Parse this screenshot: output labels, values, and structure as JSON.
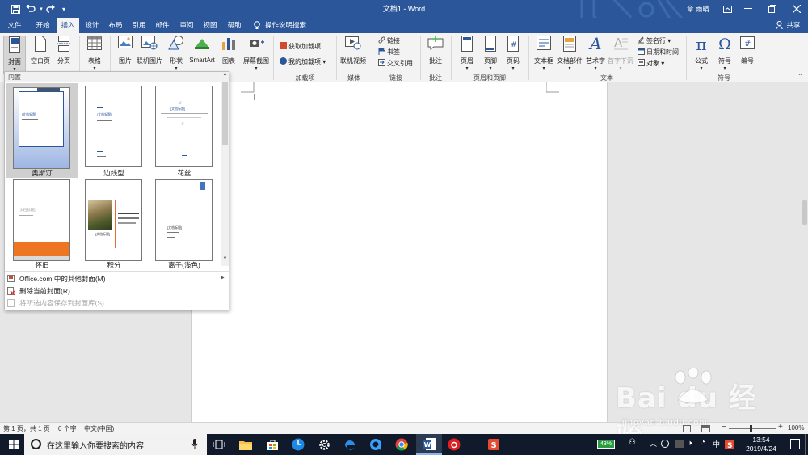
{
  "titlebar": {
    "doc_title": "文档1 - Word",
    "user": "章 雨晴",
    "quick_access": [
      "save-icon",
      "undo-icon",
      "redo-icon",
      "customize-icon"
    ]
  },
  "menu": {
    "tabs": [
      "文件",
      "开始",
      "插入",
      "设计",
      "布局",
      "引用",
      "邮件",
      "审阅",
      "视图",
      "帮助"
    ],
    "active_tab": "插入",
    "tell_me": "操作说明搜索",
    "share": "共享"
  },
  "ribbon": {
    "pages": {
      "cover": "封面",
      "blank": "空白页",
      "break": "分页"
    },
    "table": "表格",
    "illustrations": {
      "pictures": "图片",
      "online_pictures": "联机图片",
      "shapes": "形状",
      "smartart": "SmartArt",
      "chart": "图表",
      "screenshot": "屏幕截图"
    },
    "addins": {
      "get": "获取加载项",
      "my": "我的加载项",
      "group": "加载项"
    },
    "media": {
      "video": "联机视频",
      "group": "媒体"
    },
    "links": {
      "link": "链接",
      "bookmark": "书签",
      "cross_ref": "交叉引用",
      "group": "链接"
    },
    "comments": {
      "comment": "批注",
      "group": "批注"
    },
    "header_footer": {
      "header": "页眉",
      "footer": "页脚",
      "page_number": "页码",
      "group": "页眉和页脚"
    },
    "text": {
      "textbox": "文本框",
      "quickparts": "文档部件",
      "wordart": "艺术字",
      "dropcap": "首字下沉",
      "signature": "签名行",
      "datetime": "日期和时间",
      "object": "对象",
      "group": "文本"
    },
    "symbols": {
      "equation": "公式",
      "symbol": "符号",
      "number": "编号",
      "group": "符号"
    }
  },
  "cover_gallery": {
    "section_header": "内置",
    "items": [
      {
        "name": "奥斯汀",
        "title": "[文档标题]"
      },
      {
        "name": "边线型",
        "title": "[文档标题]"
      },
      {
        "name": "花丝",
        "title": "[文档标题]"
      },
      {
        "name": "怀旧",
        "title": "[文档标题]"
      },
      {
        "name": "积分",
        "title": "[文档标题]"
      },
      {
        "name": "离子(浅色)",
        "title": "[文档标题]"
      }
    ],
    "menu": [
      {
        "label": "Office.com 中的其他封面(M)",
        "enabled": true
      },
      {
        "label": "删除当前封面(R)",
        "enabled": true
      },
      {
        "label": "将所选内容保存到封面库(S)...",
        "enabled": false
      }
    ]
  },
  "statusbar": {
    "page": "第 1 页，共 1 页",
    "words": "0 个字",
    "language": "中文(中国)",
    "zoom": "100%"
  },
  "taskbar": {
    "search_placeholder": "在这里输入你要搜索的内容",
    "battery": "43%",
    "ime": "中",
    "time": "13:54",
    "date": "2019/4/24"
  },
  "watermark": {
    "brand": "Bai du 经验",
    "url": "jingyan.baidu.com"
  },
  "colors": {
    "word_blue": "#2b579a",
    "accent_orange": "#ee7623",
    "taskbar": "#101a2b"
  }
}
